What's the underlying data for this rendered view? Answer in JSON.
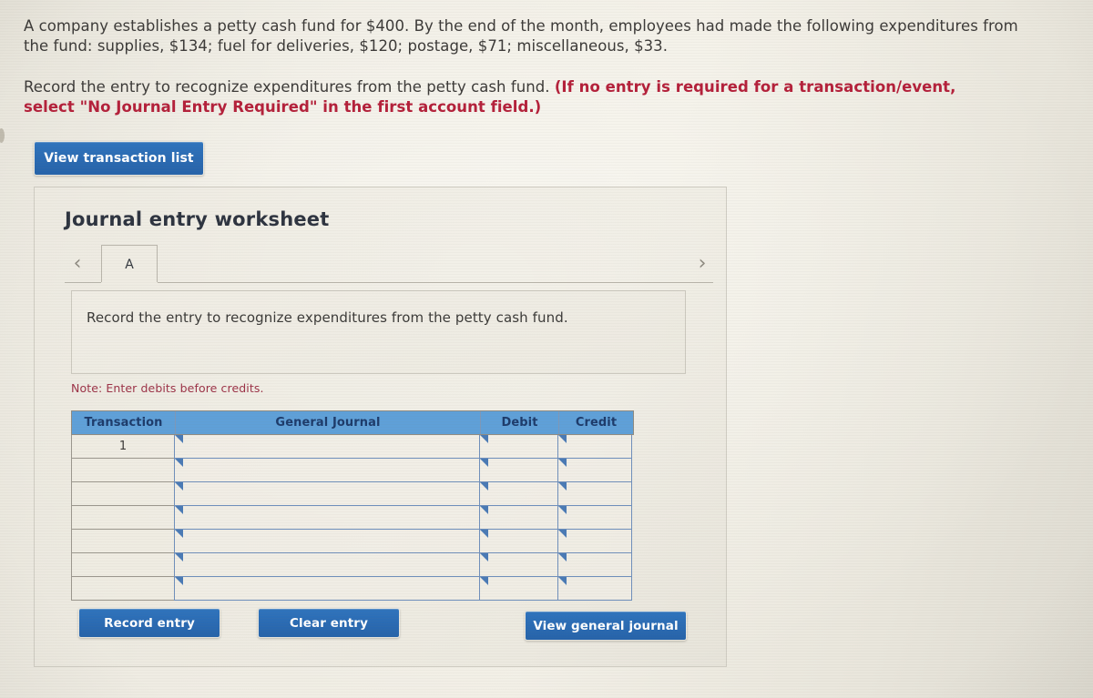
{
  "problem": {
    "paragraph_1_plain": "A company establishes a petty cash fund for $400. By the end of the month, employees had made the following expenditures from the fund: supplies, $134; fuel for deliveries, $120; postage, $71; miscellaneous, $33.",
    "paragraph_2_plain": "Record the entry to recognize expenditures from the petty cash fund. ",
    "paragraph_2_emphasis": "(If no entry is required for a transaction/event, select \"No Journal Entry Required\" in the first account field.)",
    "fund_amount": "$400",
    "expenditures": [
      {
        "label": "supplies",
        "amount": "$134"
      },
      {
        "label": "fuel for deliveries",
        "amount": "$120"
      },
      {
        "label": "postage",
        "amount": "$71"
      },
      {
        "label": "miscellaneous",
        "amount": "$33"
      }
    ]
  },
  "toolbar": {
    "view_transaction_list_label": "View transaction list"
  },
  "worksheet": {
    "title": "Journal entry worksheet",
    "prev_icon": "‹",
    "next_icon": "›",
    "tabs": [
      {
        "label": "A",
        "active": true
      }
    ],
    "instruction": "Record the entry to recognize expenditures from the petty cash fund.",
    "note": "Note: Enter debits before credits.",
    "table": {
      "headers": [
        "Transaction",
        "General Journal",
        "Debit",
        "Credit"
      ],
      "rows": [
        {
          "transaction": "1",
          "general_journal": "",
          "debit": "",
          "credit": ""
        },
        {
          "transaction": "",
          "general_journal": "",
          "debit": "",
          "credit": ""
        },
        {
          "transaction": "",
          "general_journal": "",
          "debit": "",
          "credit": ""
        },
        {
          "transaction": "",
          "general_journal": "",
          "debit": "",
          "credit": ""
        },
        {
          "transaction": "",
          "general_journal": "",
          "debit": "",
          "credit": ""
        },
        {
          "transaction": "",
          "general_journal": "",
          "debit": "",
          "credit": ""
        },
        {
          "transaction": "",
          "general_journal": "",
          "debit": "",
          "credit": ""
        }
      ]
    },
    "actions": {
      "record_entry_label": "Record entry",
      "clear_entry_label": "Clear entry",
      "view_general_journal_label": "View general journal"
    }
  },
  "colors": {
    "page_background": "#edeae1",
    "button_blue": "#2a6ab2",
    "table_header_blue": "#5fa0d8",
    "table_header_text": "#1d3b6b",
    "emphasis_red": "#b4203a",
    "note_red": "#9c3247",
    "body_text": "#3c3a38",
    "cell_border_blue": "#6f8fbb"
  }
}
